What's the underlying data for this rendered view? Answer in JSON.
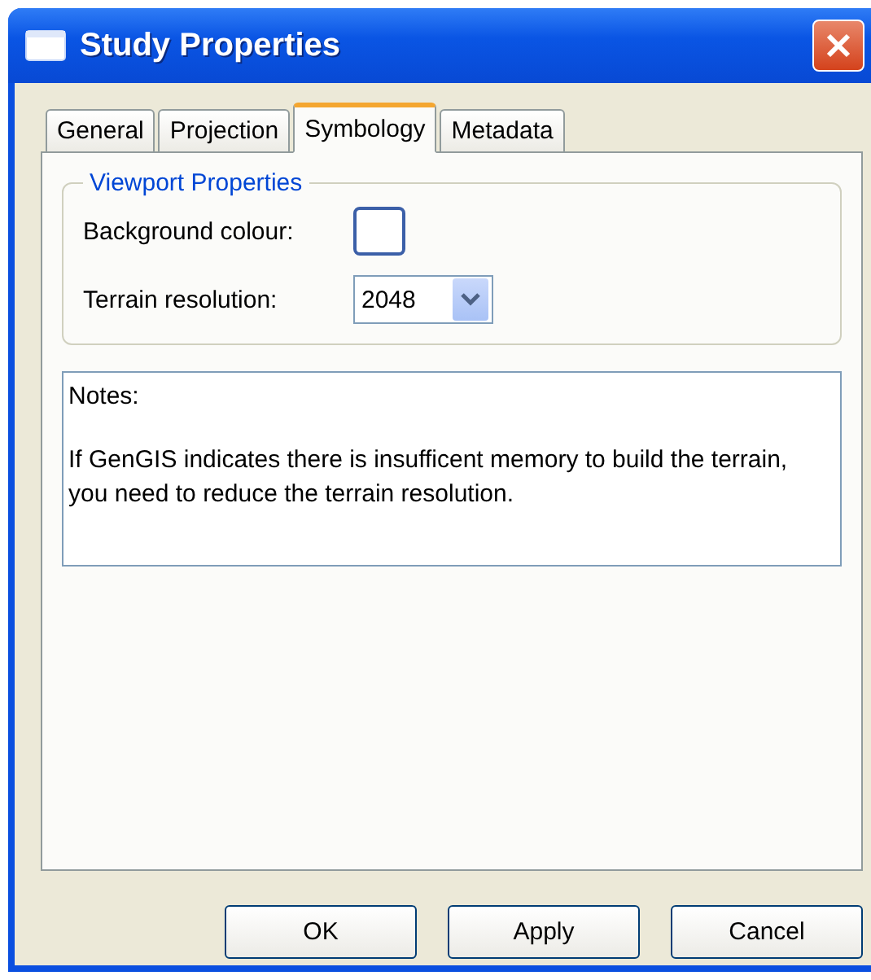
{
  "window": {
    "title": "Study Properties"
  },
  "tabs": [
    {
      "label": "General",
      "selected": false
    },
    {
      "label": "Projection",
      "selected": false
    },
    {
      "label": "Symbology",
      "selected": true
    },
    {
      "label": "Metadata",
      "selected": false
    }
  ],
  "group": {
    "title": "Viewport Properties",
    "background_colour": {
      "label": "Background colour:",
      "color": "#ffffff"
    },
    "terrain_resolution": {
      "label": "Terrain resolution:",
      "value": "2048"
    }
  },
  "notes": {
    "heading": "Notes:",
    "text": "If GenGIS indicates there is insufficent memory to build the terrain, you need to reduce the terrain resolution."
  },
  "buttons": [
    "OK",
    "Apply",
    "Cancel"
  ]
}
